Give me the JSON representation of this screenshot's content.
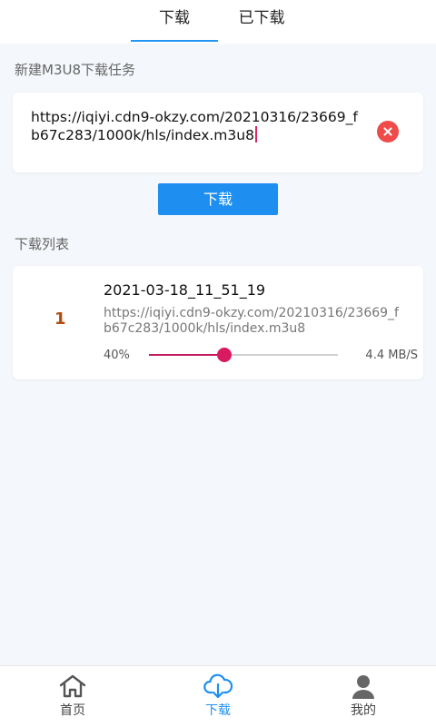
{
  "tabs": {
    "download": "下载",
    "downloaded": "已下载"
  },
  "new_task": {
    "label": "新建M3U8下载任务",
    "url_value": "https://iqiyi.cdn9-okzy.com/20210316/23669_fb67c283/1000k/hls/index.m3u8",
    "download_button": "下载"
  },
  "list": {
    "label": "下载列表",
    "items": [
      {
        "index": "1",
        "name": "2021-03-18_11_51_19",
        "url": "https://iqiyi.cdn9-okzy.com/20210316/23669_fb67c283/1000k/hls/index.m3u8",
        "percent_text": "40%",
        "progress": 0.4,
        "speed": "4.4 MB/S"
      }
    ]
  },
  "bottom_nav": {
    "home": "首页",
    "download": "下载",
    "mine": "我的",
    "active": "download"
  },
  "colors": {
    "accent": "#1e8ff0",
    "progress": "#d81b60",
    "clear": "#ef4b4b",
    "index": "#b24d0f"
  },
  "icons": {
    "clear": "clear-icon",
    "home": "home-icon",
    "download": "cloud-download-icon",
    "mine": "user-icon"
  }
}
